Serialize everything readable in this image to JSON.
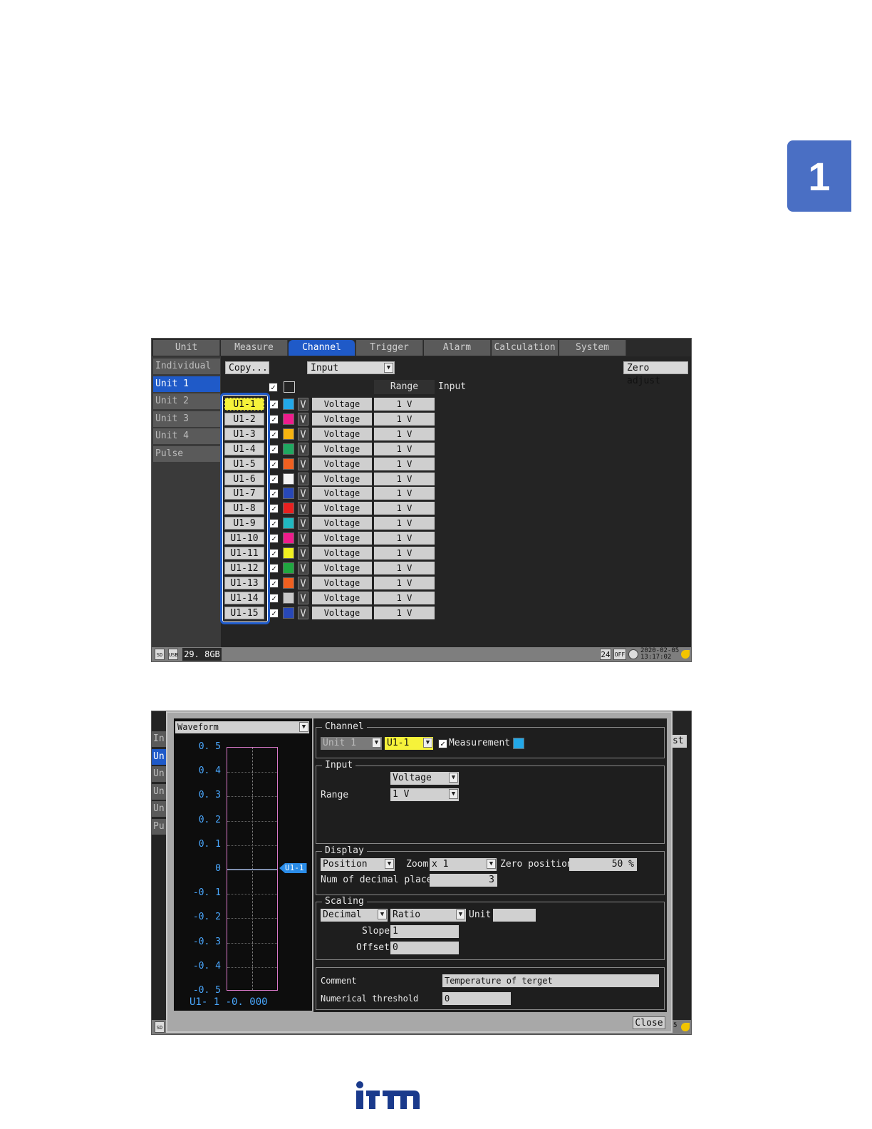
{
  "chapter_number": "1",
  "screen1": {
    "tabs": [
      "Unit",
      "Measure",
      "Channel",
      "Trigger",
      "Alarm",
      "Calculation",
      "System"
    ],
    "active_tab": "Channel",
    "side_items": [
      "Individual",
      "Unit 1",
      "Unit 2",
      "Unit 3",
      "Unit 4",
      "Pulse"
    ],
    "active_side": "Unit 1",
    "copy_button": "Copy...",
    "view_select": "Input",
    "zero_adjust": "Zero adjust",
    "range_header": "Range",
    "input_header": "Input",
    "channels": [
      {
        "name": "U1-1",
        "color": "#22a8e8",
        "type": "Voltage",
        "range": "1 V"
      },
      {
        "name": "U1-2",
        "color": "#ee1c8c",
        "type": "Voltage",
        "range": "1 V"
      },
      {
        "name": "U1-3",
        "color": "#f8b410",
        "type": "Voltage",
        "range": "1 V"
      },
      {
        "name": "U1-4",
        "color": "#20a860",
        "type": "Voltage",
        "range": "1 V"
      },
      {
        "name": "U1-5",
        "color": "#f06020",
        "type": "Voltage",
        "range": "1 V"
      },
      {
        "name": "U1-6",
        "color": "#f4f4f4",
        "type": "Voltage",
        "range": "1 V"
      },
      {
        "name": "U1-7",
        "color": "#2848b8",
        "type": "Voltage",
        "range": "1 V"
      },
      {
        "name": "U1-8",
        "color": "#e82020",
        "type": "Voltage",
        "range": "1 V"
      },
      {
        "name": "U1-9",
        "color": "#20b8c0",
        "type": "Voltage",
        "range": "1 V"
      },
      {
        "name": "U1-10",
        "color": "#ee1c8c",
        "type": "Voltage",
        "range": "1 V"
      },
      {
        "name": "U1-11",
        "color": "#f0f020",
        "type": "Voltage",
        "range": "1 V"
      },
      {
        "name": "U1-12",
        "color": "#20a840",
        "type": "Voltage",
        "range": "1 V"
      },
      {
        "name": "U1-13",
        "color": "#f06020",
        "type": "Voltage",
        "range": "1 V"
      },
      {
        "name": "U1-14",
        "color": "#c8c8c8",
        "type": "Voltage",
        "range": "1 V"
      },
      {
        "name": "U1-15",
        "color": "#2848b8",
        "type": "Voltage",
        "range": "1 V"
      }
    ],
    "status": {
      "sd": "SD",
      "usb": "USB",
      "storage": "29. 8GB",
      "mode_24": "24",
      "off": "OFF",
      "datetime": "2020-02-05 13:17:02"
    }
  },
  "screen2": {
    "wave_select": "Waveform",
    "y_ticks": [
      "0. 5",
      "0. 4",
      "0. 3",
      "0. 2",
      "0. 1",
      "0",
      "-0. 1",
      "-0. 2",
      "-0. 3",
      "-0. 4",
      "-0. 5"
    ],
    "marker_label": "U1-1",
    "readout": "U1- 1 -0. 000",
    "bg_side": [
      "In",
      "Un",
      "Un",
      "Un",
      "Un",
      "Pu"
    ],
    "bg_right": "st",
    "channel_group": "Channel",
    "unit_select": "Unit 1",
    "channel_select": "U1-1",
    "measurement_label": "Measurement",
    "measurement_color": "#22a8e8",
    "input_group": "Input",
    "input_type": "Voltage",
    "range_label": "Range",
    "range_value": "1 V",
    "display_group": "Display",
    "display_mode": "Position",
    "zoom_label": "Zoom",
    "zoom_value": "x 1",
    "zero_position_label": "Zero position",
    "zero_position_value": "50 %",
    "decimal_label": "Num of decimal places",
    "decimal_value": "3",
    "scaling_group": "Scaling",
    "scaling_format": "Decimal",
    "scaling_mode": "Ratio",
    "unit_label": "Unit",
    "unit_value": "",
    "slope_label": "Slope",
    "slope_value": "1",
    "offset_label": "Offset",
    "offset_value": "0",
    "comment_label": "Comment",
    "comment_value": "Temperature of terget",
    "threshold_label": "Numerical threshold",
    "threshold_value": "0",
    "close_button": "Close",
    "sd": "SD",
    "corner_text": "5"
  }
}
